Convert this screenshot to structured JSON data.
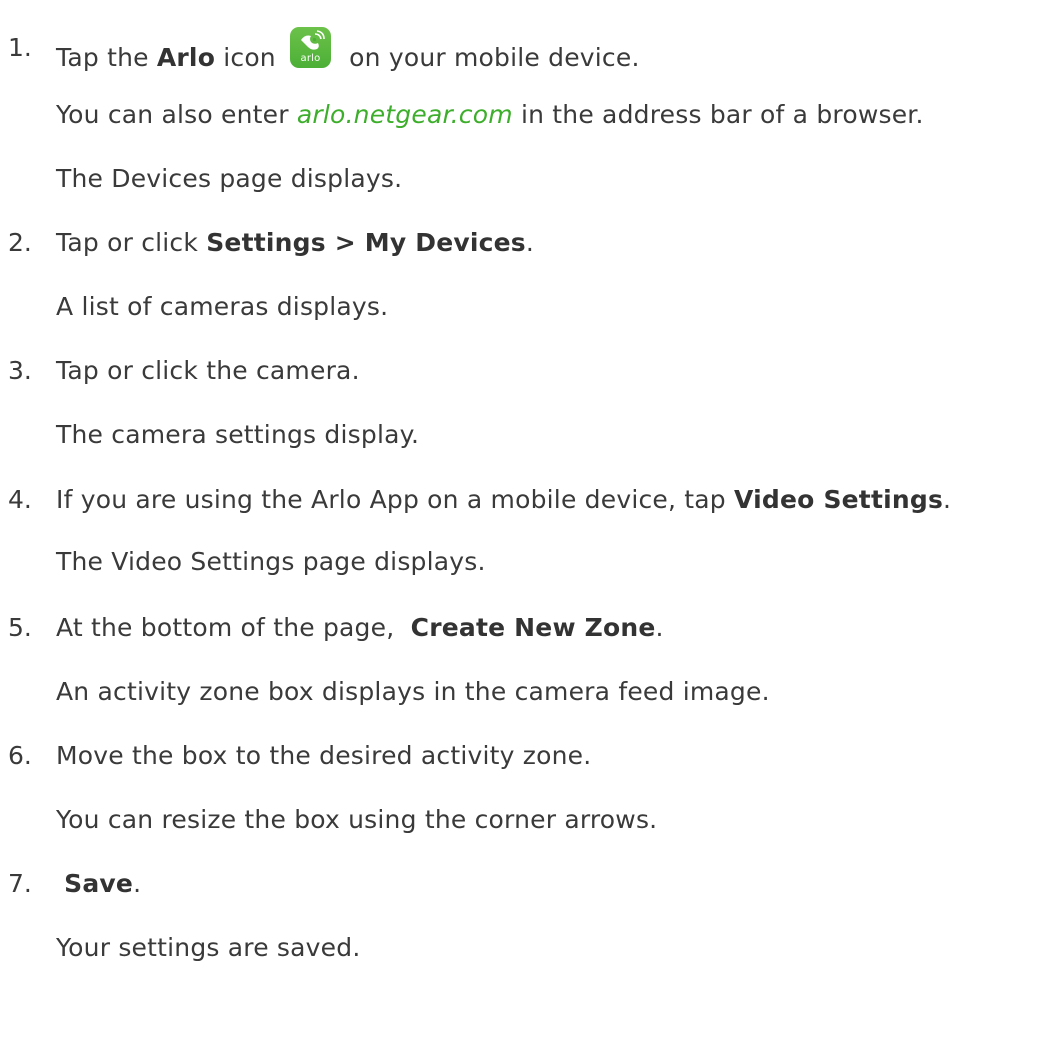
{
  "steps": [
    {
      "number": "1.",
      "parts": {
        "before": "Tap the ",
        "bold": "Arlo",
        "middle": " icon ",
        "after": " on your mobile device."
      },
      "notes": [
        {
          "before": "You can also enter ",
          "link": "arlo.netgear.com",
          "after": " in the address bar of a browser."
        },
        {
          "text": "The Devices page displays."
        }
      ]
    },
    {
      "number": "2.",
      "parts": {
        "before": "Tap or click ",
        "bold": "Settings > My Devices",
        "after": "."
      },
      "notes": [
        {
          "text": "A list of cameras displays."
        }
      ]
    },
    {
      "number": "3.",
      "parts": {
        "text": "Tap or click the camera."
      },
      "notes": [
        {
          "text": "The camera settings display."
        }
      ]
    },
    {
      "number": "4.",
      "parts": {
        "before": "If you are using the Arlo App on a mobile device, tap ",
        "bold": "Video Settings",
        "after": "."
      },
      "notes": [
        {
          "text": "The Video Settings page displays."
        }
      ]
    },
    {
      "number": "5.",
      "parts": {
        "before": "At the bottom of the page,  ",
        "bold": "Create New Zone",
        "after": "."
      },
      "notes": [
        {
          "text": "An activity zone box displays in the camera feed image."
        }
      ]
    },
    {
      "number": "6.",
      "parts": {
        "text": "Move the box to the desired activity zone."
      },
      "notes": [
        {
          "text": "You can resize the box using the corner arrows."
        }
      ]
    },
    {
      "number": "7.",
      "parts": {
        "before": " ",
        "bold": "Save",
        "after": "."
      },
      "notes": [
        {
          "text": "Your settings are saved."
        }
      ]
    }
  ],
  "icons": {
    "arlo_app": "arlo-app-icon",
    "arlo_app_text": "arlo"
  },
  "colors": {
    "text": "#3a3a3a",
    "link": "#3dae2b",
    "icon_bg": "#5bb840"
  }
}
